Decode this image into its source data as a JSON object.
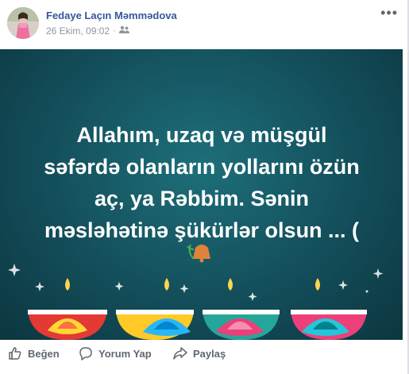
{
  "post": {
    "author": "Fedaye Laçın Məmmədova",
    "timestamp": "26 Ekim, 09:02",
    "separator": "·",
    "audience_icon": "friends-icon",
    "more_icon": "more-options-icon",
    "more_label": "•••"
  },
  "image": {
    "text_lines": [
      "Allahım, uzaq və müşgül",
      "səfərdə olanların yollarını özün",
      "aç, ya Rəbbim. Sənin",
      "məsləhətinə şükürlər olsun ... ("
    ],
    "background_color": "#134e5a",
    "emoji_icon": "bell-with-flower-icon"
  },
  "actions": {
    "like_label": "Beğen",
    "comment_label": "Yorum Yap",
    "share_label": "Paylaş",
    "like_icon": "thumbs-up-icon",
    "comment_icon": "speech-bubble-icon",
    "share_icon": "share-arrow-icon"
  },
  "colors": {
    "author_link": "#365899",
    "meta_text": "#90949c",
    "action_text": "#606770"
  }
}
